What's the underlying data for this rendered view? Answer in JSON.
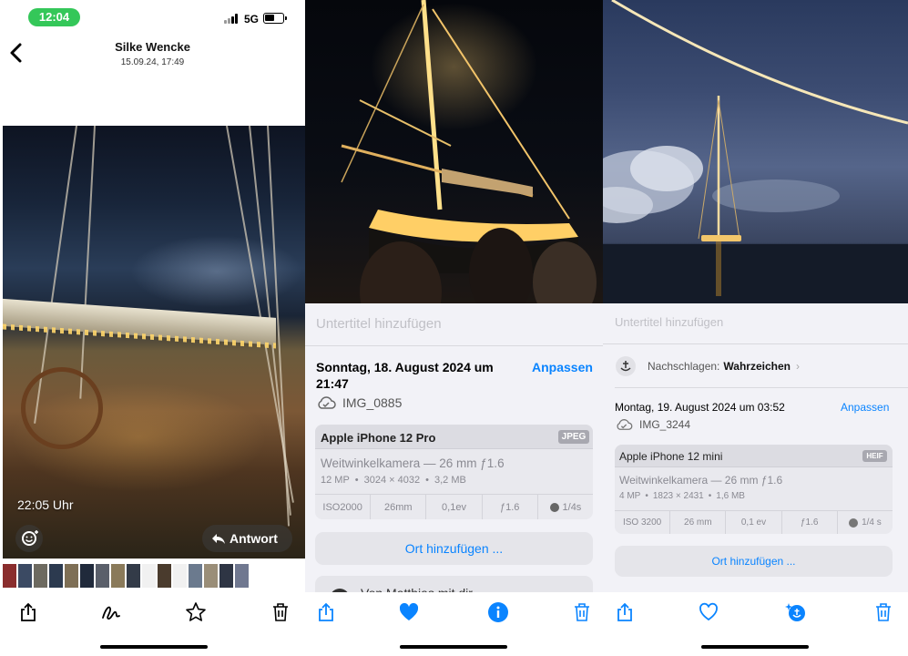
{
  "panel1": {
    "status": {
      "time": "12:04",
      "network": "5G"
    },
    "header": {
      "title": "Silke Wencke",
      "subtitle": "15.09.24, 17:49"
    },
    "photo": {
      "timestamp": "22:05 Uhr"
    },
    "reply_label": "Antwort",
    "icons": {
      "share": "share-icon",
      "markup": "markup-icon",
      "favorite": "star-icon",
      "delete": "trash-icon"
    }
  },
  "panel2": {
    "caption_placeholder": "Untertitel hinzufügen",
    "date_line1": "Sonntag, 18. August 2024 um",
    "date_line2": "21:47",
    "adjust": "Anpassen",
    "filename": "IMG_0885",
    "device": "Apple iPhone 12 Pro",
    "format": "JPEG",
    "lens": "Weitwinkelkamera — 26 mm ƒ1.6",
    "specs": [
      "12 MP",
      "3024 × 4032",
      "3,2 MB"
    ],
    "exif": [
      "ISO2000",
      "26mm",
      "0,1ev",
      "ƒ1.6",
      "1/4s"
    ],
    "add_location": "Ort hinzufügen ...",
    "partial_text": "Von Matthias mit dir"
  },
  "panel3": {
    "caption_placeholder": "Untertitel hinzufügen",
    "lookup_prefix": "Nachschlagen:",
    "lookup_value": "Wahrzeichen",
    "date_line": "Montag, 19. August 2024 um 03:52",
    "adjust": "Anpassen",
    "filename": "IMG_3244",
    "device": "Apple iPhone 12 mini",
    "format": "HEIF",
    "lens": "Weitwinkelkamera — 26 mm ƒ1.6",
    "specs": [
      "4 MP",
      "1823 × 2431",
      "1,6 MB"
    ],
    "exif": [
      "ISO 3200",
      "26 mm",
      "0,1 ev",
      "ƒ1.6",
      "1/4 s"
    ],
    "add_location": "Ort hinzufügen ..."
  },
  "colors": {
    "accent": "#0a84ff",
    "status_green": "#34c759"
  }
}
